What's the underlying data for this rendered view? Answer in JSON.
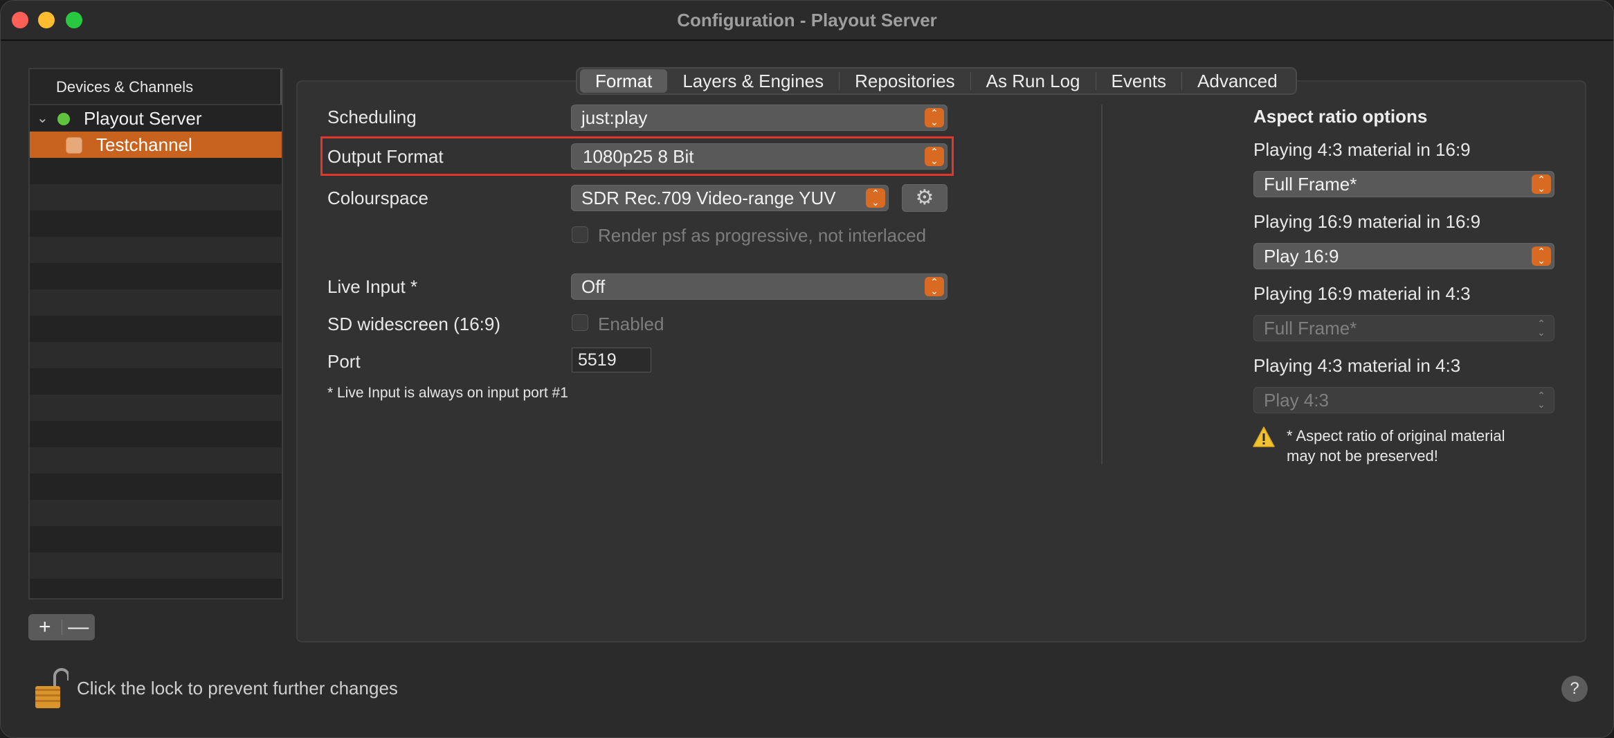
{
  "window": {
    "title": "Configuration - Playout Server"
  },
  "sidebar": {
    "header": "Devices & Channels",
    "server": {
      "label": "Playout Server",
      "status_color": "#5fc33e"
    },
    "channel": {
      "label": "Testchannel"
    },
    "add_label": "+",
    "remove_label": "—"
  },
  "tabs": [
    "Format",
    "Layers & Engines",
    "Repositories",
    "As Run Log",
    "Events",
    "Advanced"
  ],
  "active_tab": "Format",
  "form": {
    "scheduling": {
      "label": "Scheduling",
      "value": "just:play"
    },
    "output_format": {
      "label": "Output Format",
      "value": "1080p25 8 Bit"
    },
    "colourspace": {
      "label": "Colourspace",
      "value": "SDR Rec.709 Video-range YUV"
    },
    "psf": {
      "label": "Render psf as progressive, not interlaced",
      "checked": false
    },
    "live_input": {
      "label": "Live Input *",
      "value": "Off"
    },
    "sd_widescreen": {
      "label": "SD widescreen (16:9)",
      "checkbox_label": "Enabled",
      "checked": false
    },
    "port": {
      "label": "Port",
      "value": "5519"
    },
    "note": "* Live Input is always on input port #1"
  },
  "aspect": {
    "title": "Aspect ratio options",
    "options": [
      {
        "label": "Playing 4:3 material in 16:9",
        "value": "Full Frame*",
        "enabled": true
      },
      {
        "label": "Playing 16:9 material in 16:9",
        "value": "Play 16:9",
        "enabled": true
      },
      {
        "label": "Playing 16:9 material in 4:3",
        "value": "Full Frame*",
        "enabled": false
      },
      {
        "label": "Playing 4:3 material in 4:3",
        "value": "Play 4:3",
        "enabled": false
      }
    ],
    "warning_line1": "* Aspect ratio of original material",
    "warning_line2": "may not be preserved!"
  },
  "footer": {
    "lock_text": "Click the lock to prevent further changes",
    "help_label": "?"
  },
  "colors": {
    "accent": "#d86a21",
    "selection": "#c8621f",
    "highlight": "#e2382a"
  }
}
